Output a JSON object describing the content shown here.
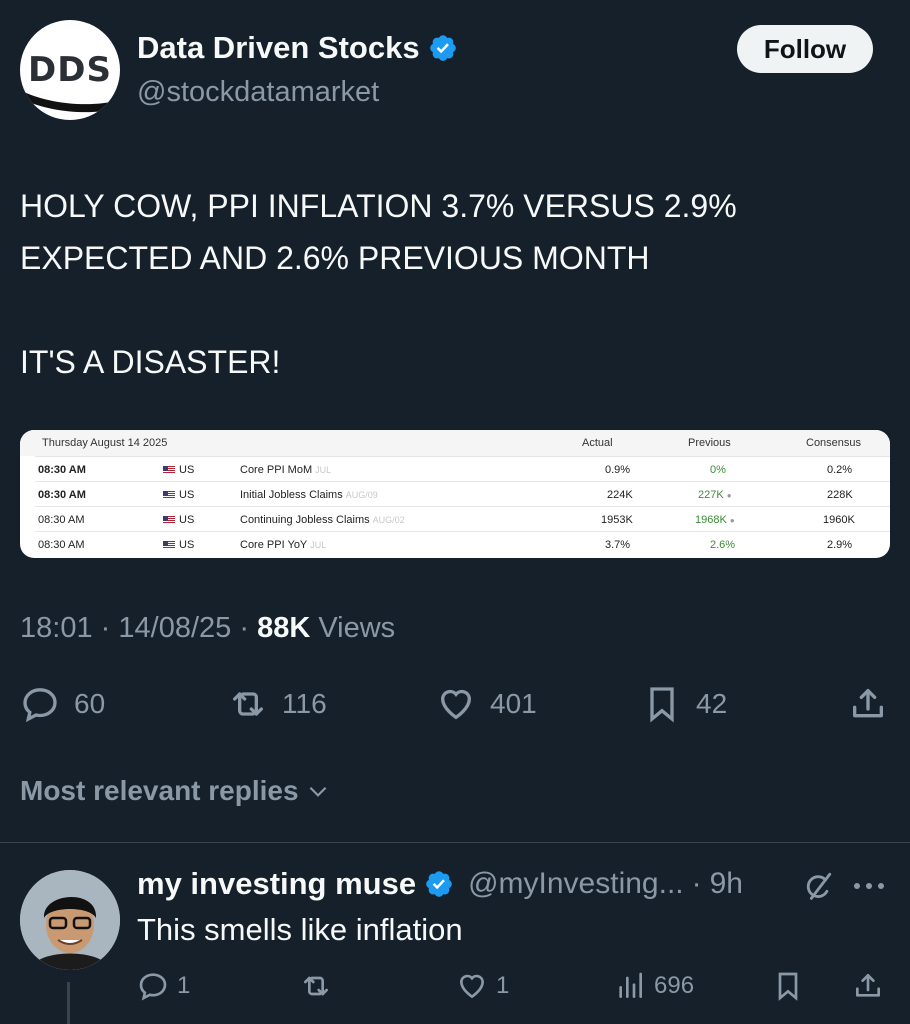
{
  "tweet": {
    "author": {
      "name": "Data Driven Stocks",
      "handle": "@stockdatamarket",
      "avatar_text": "DDS"
    },
    "follow_label": "Follow",
    "text": "HOLY COW, PPI INFLATION 3.7% VERSUS 2.9%\nEXPECTED AND 2.6% PREVIOUS MONTH\n\nIT'S A DISASTER!",
    "time": "18:01",
    "date": "14/08/25",
    "views_count": "88K",
    "views_label": "Views",
    "stats": {
      "replies": "60",
      "reposts": "116",
      "likes": "401",
      "bookmarks": "42"
    }
  },
  "embedded_table": {
    "date_header": "Thursday August 14 2025",
    "headers": {
      "actual": "Actual",
      "previous": "Previous",
      "consensus": "Consensus"
    },
    "rows": [
      {
        "time": "08:30 AM",
        "country": "US",
        "event": "Core PPI MoM",
        "ref": "JUL",
        "actual": "0.9%",
        "previous": "0%",
        "consensus": "0.2%"
      },
      {
        "time": "08:30 AM",
        "country": "US",
        "event": "Initial Jobless Claims",
        "ref": "AUG/09",
        "actual": "224K",
        "previous": "227K",
        "consensus": "228K"
      },
      {
        "time": "08:30 AM",
        "country": "US",
        "event": "Continuing Jobless Claims",
        "ref": "AUG/02",
        "actual": "1953K",
        "previous": "1968K",
        "consensus": "1960K"
      },
      {
        "time": "08:30 AM",
        "country": "US",
        "event": "Core PPI YoY",
        "ref": "JUL",
        "actual": "3.7%",
        "previous": "2.6%",
        "consensus": "2.9%"
      }
    ]
  },
  "replies_filter": "Most relevant replies",
  "reply": {
    "name": "my investing muse",
    "handle": "@myInvesting...",
    "age": "9h",
    "text": "This smells like inflation",
    "stats": {
      "replies": "1",
      "likes": "1",
      "views": "696"
    }
  },
  "colors": {
    "background": "#15202b",
    "verified": "#1d9bf0",
    "secondary_text": "#8b98a5"
  }
}
